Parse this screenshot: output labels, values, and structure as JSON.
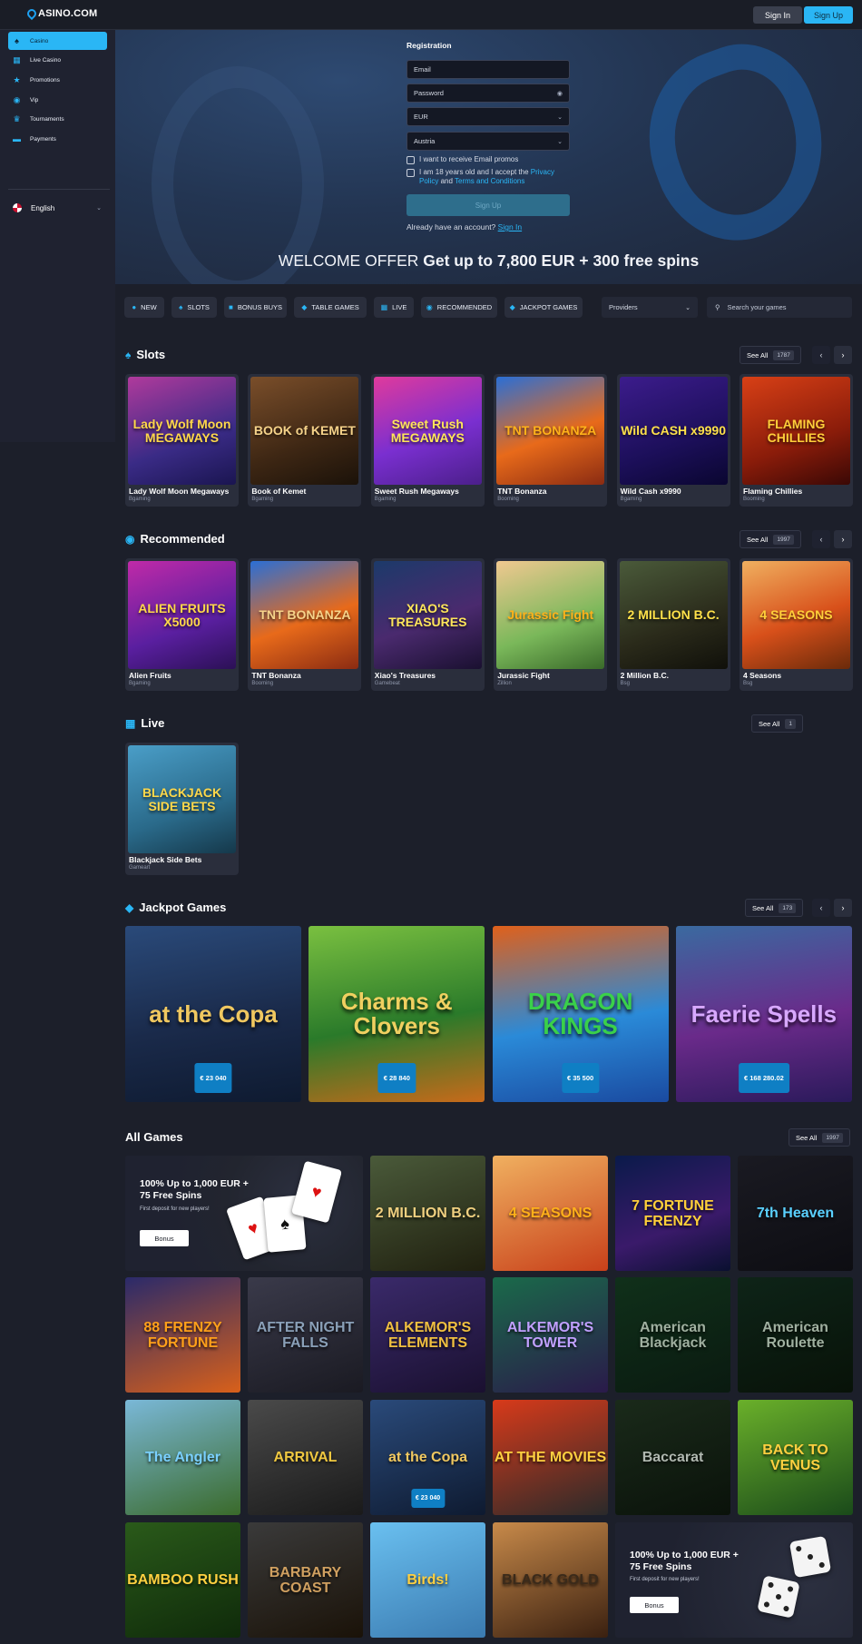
{
  "header": {
    "logo": "ASINO.COM",
    "signin": "Sign In",
    "signup": "Sign Up"
  },
  "sidebar": {
    "items": [
      {
        "label": "Casino",
        "icon": "spade-icon",
        "active": true
      },
      {
        "label": "Live Casino",
        "icon": "grid-icon"
      },
      {
        "label": "Promotions",
        "icon": "star-icon"
      },
      {
        "label": "Vip",
        "icon": "vip-icon"
      },
      {
        "label": "Tournaments",
        "icon": "trophy-icon"
      },
      {
        "label": "Payments",
        "icon": "card-icon"
      }
    ],
    "language": "English"
  },
  "registration": {
    "title": "Registration",
    "email_placeholder": "Email",
    "password_placeholder": "Password",
    "currency": "EUR",
    "country": "Austria",
    "email_promos": "I want to receive Email promos",
    "age_text_1": "I am 18 years old and I accept the ",
    "privacy_link": "Privacy Policy",
    "and": " and ",
    "terms_link": "Terms and Conditions",
    "signup_button": "Sign Up",
    "already": "Already have an account? ",
    "signin_link": "Sign In"
  },
  "welcome": {
    "prefix": "WELCOME OFFER ",
    "offer": "Get up to 7,800 EUR + 300 free spins"
  },
  "filters": {
    "chips": [
      "NEW",
      "SLOTS",
      "BONUS BUYS",
      "TABLE GAMES",
      "LIVE",
      "RECOMMENDED",
      "JACKPOT GAMES"
    ],
    "providers": "Providers",
    "search_placeholder": "Search your games"
  },
  "sections": {
    "slots": {
      "title": "Slots",
      "see_all": "See All",
      "count": "1787",
      "games": [
        {
          "name": "Lady Wolf Moon Megaways",
          "provider": "Bgaming",
          "art": "Lady Wolf Moon MEGAWAYS"
        },
        {
          "name": "Book of Kemet",
          "provider": "Bgaming",
          "art": "BOOK of KEMET"
        },
        {
          "name": "Sweet Rush Megaways",
          "provider": "Bgaming",
          "art": "Sweet Rush MEGAWAYS"
        },
        {
          "name": "TNT Bonanza",
          "provider": "Booming",
          "art": "TNT BONANZA"
        },
        {
          "name": "Wild Cash x9990",
          "provider": "Bgaming",
          "art": "Wild CASH x9990"
        },
        {
          "name": "Flaming Chillies",
          "provider": "Booming",
          "art": "FLAMING CHILLIES"
        }
      ]
    },
    "recommended": {
      "title": "Recommended",
      "see_all": "See All",
      "count": "1997",
      "games": [
        {
          "name": "Alien Fruits",
          "provider": "Bgaming",
          "art": "ALIEN FRUITS X5000"
        },
        {
          "name": "TNT Bonanza",
          "provider": "Booming",
          "art": "TNT BONANZA"
        },
        {
          "name": "Xiao's Treasures",
          "provider": "Gamebeat",
          "art": "XIAO'S TREASURES"
        },
        {
          "name": "Jurassic Fight",
          "provider": "Zillion",
          "art": "Jurassic Fight"
        },
        {
          "name": "2 Million B.C.",
          "provider": "Bsg",
          "art": "2 MILLION B.C."
        },
        {
          "name": "4 Seasons",
          "provider": "Bsg",
          "art": "4 SEASONS"
        }
      ]
    },
    "live": {
      "title": "Live",
      "see_all": "See All",
      "count": "1",
      "games": [
        {
          "name": "Blackjack Side Bets",
          "provider": "Gameart",
          "art": "BLACKJACK SIDE BETS"
        }
      ]
    },
    "jackpot": {
      "title": "Jackpot Games",
      "see_all": "See All",
      "count": "173",
      "games": [
        {
          "art": "at the Copa",
          "amount": "€ 23 040"
        },
        {
          "art": "Charms & Clovers",
          "amount": "€ 28 840"
        },
        {
          "art": "DRAGON KINGS",
          "amount": "€ 35 500"
        },
        {
          "art": "Faerie Spells",
          "amount": "€ 168 280.02"
        }
      ]
    },
    "all": {
      "title": "All Games",
      "see_all": "See All",
      "count": "1997",
      "promo1": {
        "title": "100% Up to 1,000 EUR + 75 Free Spins",
        "sub": "First deposit for new players!",
        "button": "Bonus"
      },
      "promo2": {
        "title": "100% Up to 1,000 EUR + 75 Free Spins",
        "sub": "First deposit for new players!",
        "button": "Bonus"
      },
      "tiles": [
        "2 MILLION B.C.",
        "4 SEASONS",
        "7 FORTUNE FRENZY",
        "7th Heaven",
        "88 FRENZY FORTUNE",
        "AFTER NIGHT FALLS",
        "ALKEMOR'S ELEMENTS",
        "ALKEMOR'S TOWER",
        "American Blackjack",
        "American Roulette",
        "The Angler",
        "ARRIVAL",
        "at the Copa",
        "AT THE MOVIES",
        "Baccarat",
        "BACK TO VENUS",
        "BAMBOO RUSH",
        "BARBARY COAST",
        "Birds!",
        "BLACK GOLD"
      ],
      "copa_amount": "€ 23 040"
    }
  }
}
